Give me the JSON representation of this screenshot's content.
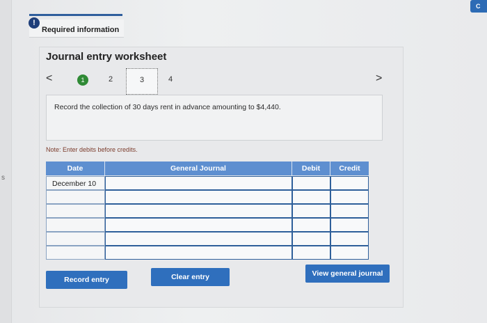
{
  "colors": {
    "accent": "#2f6fbd",
    "header_blue": "#5e8fd0",
    "step_active": "#2f8a35",
    "alert": "#1f3f7a"
  },
  "left_strip_char": "s",
  "top_right_button": "C",
  "required_info": {
    "alert_icon_glyph": "!",
    "label": "Required information"
  },
  "worksheet": {
    "title": "Journal entry worksheet",
    "nav": {
      "prev_glyph": "<",
      "next_glyph": ">",
      "steps": [
        "1",
        "2",
        "3",
        "4"
      ],
      "active_step": "1"
    },
    "description": "Record the collection of 30 days rent in advance amounting to $4,440.",
    "note": "Note: Enter debits before credits.",
    "table": {
      "headers": {
        "date": "Date",
        "general_journal": "General Journal",
        "debit": "Debit",
        "credit": "Credit"
      },
      "rows": [
        {
          "date": "December 10",
          "account": "",
          "debit": "",
          "credit": ""
        },
        {
          "date": "",
          "account": "",
          "debit": "",
          "credit": ""
        },
        {
          "date": "",
          "account": "",
          "debit": "",
          "credit": ""
        },
        {
          "date": "",
          "account": "",
          "debit": "",
          "credit": ""
        },
        {
          "date": "",
          "account": "",
          "debit": "",
          "credit": ""
        },
        {
          "date": "",
          "account": "",
          "debit": "",
          "credit": ""
        }
      ]
    },
    "buttons": {
      "record_entry": "Record entry",
      "clear_entry": "Clear entry",
      "view_general_journal": "View general journal"
    }
  }
}
